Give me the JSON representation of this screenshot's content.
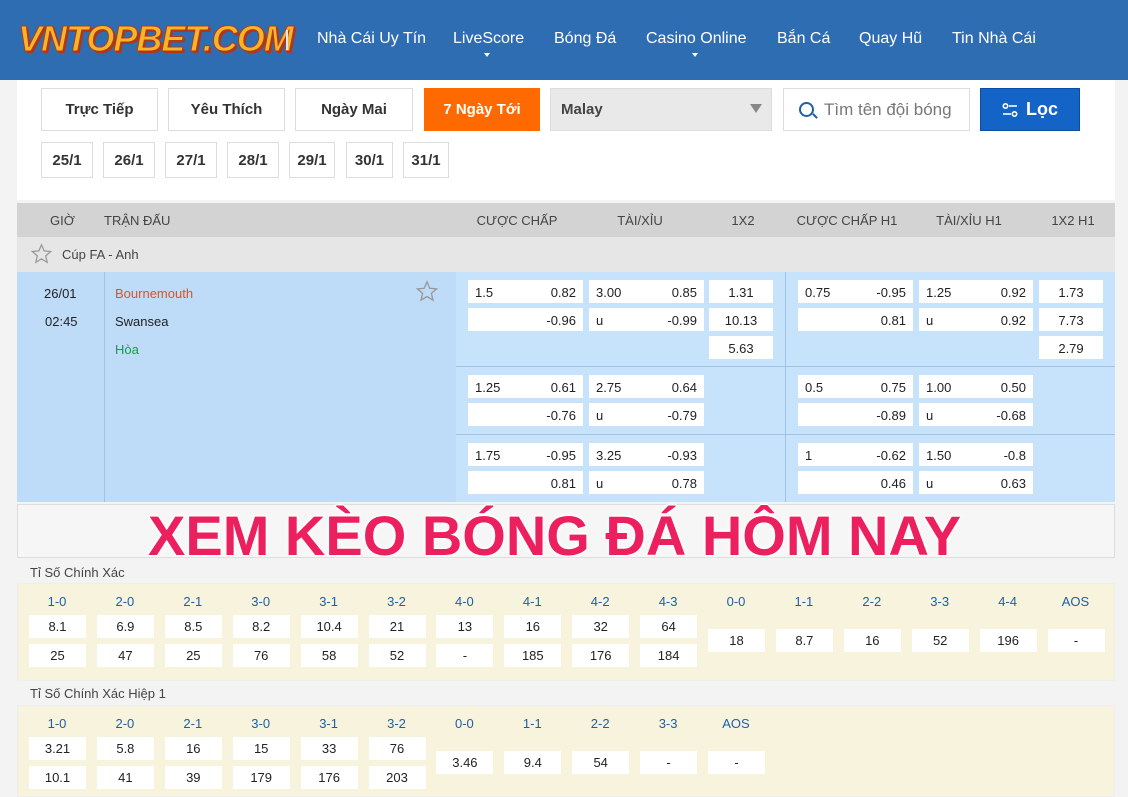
{
  "header": {
    "logo": "VNTOPBET.COM",
    "nav": [
      {
        "label": "Nhà Cái Uy Tín",
        "caret": false
      },
      {
        "label": "LiveScore",
        "caret": true
      },
      {
        "label": "Bóng Đá",
        "caret": false
      },
      {
        "label": "Casino Online",
        "caret": true
      },
      {
        "label": "Bắn Cá",
        "caret": false
      },
      {
        "label": "Quay Hũ",
        "caret": false
      },
      {
        "label": "Tin Nhà Cái",
        "caret": false
      }
    ]
  },
  "filters": {
    "tabs": [
      {
        "label": "Trực Tiếp",
        "active": false
      },
      {
        "label": "Yêu Thích",
        "active": false
      },
      {
        "label": "Ngày Mai",
        "active": false
      },
      {
        "label": "7 Ngày Tới",
        "active": true
      }
    ],
    "odds_format": "Malay",
    "search_placeholder": "Tìm tên đội bóng",
    "filter_button": "Lọc",
    "dates": [
      "25/1",
      "26/1",
      "27/1",
      "28/1",
      "29/1",
      "30/1",
      "31/1"
    ]
  },
  "table": {
    "headers": {
      "time": "GIỜ",
      "match": "TRẬN ĐẤU",
      "handicap": "CƯỢC CHẤP",
      "ou": "TÀI/XỈU",
      "x12": "1X2",
      "handicap_h1": "CƯỢC CHẤP H1",
      "ou_h1": "TÀI/XỈU H1",
      "x12_h1": "1X2 H1"
    },
    "league": "Cúp FA - Anh",
    "match": {
      "date": "26/01",
      "time": "02:45",
      "home": "Bournemouth",
      "away": "Swansea",
      "draw": "Hòa",
      "lines": [
        {
          "hdp": [
            "1.5",
            "0.82",
            "-0.96"
          ],
          "ou": [
            "3.00",
            "0.85",
            "u",
            "-0.99"
          ],
          "x12": [
            "1.31",
            "10.13",
            "5.63"
          ],
          "hdp_h1": [
            "0.75",
            "-0.95",
            "0.81"
          ],
          "ou_h1": [
            "1.25",
            "0.92",
            "u",
            "0.92"
          ],
          "x12_h1": [
            "1.73",
            "7.73",
            "2.79"
          ]
        },
        {
          "hdp": [
            "1.25",
            "0.61",
            "-0.76"
          ],
          "ou": [
            "2.75",
            "0.64",
            "u",
            "-0.79"
          ],
          "hdp_h1": [
            "0.5",
            "0.75",
            "-0.89"
          ],
          "ou_h1": [
            "1.00",
            "0.50",
            "u",
            "-0.68"
          ]
        },
        {
          "hdp": [
            "1.75",
            "-0.95",
            "0.81"
          ],
          "ou": [
            "3.25",
            "-0.93",
            "u",
            "0.78"
          ],
          "hdp_h1": [
            "1",
            "-0.62",
            "0.46"
          ],
          "ou_h1": [
            "1.50",
            "-0.8",
            "u",
            "0.63"
          ]
        }
      ]
    }
  },
  "banner": "XEM KÈO BÓNG ĐÁ HÔM NAY",
  "correct_score": {
    "title": "Tỉ Số Chính Xác",
    "items": [
      {
        "s": "1-0",
        "v": [
          "8.1",
          "25"
        ]
      },
      {
        "s": "2-0",
        "v": [
          "6.9",
          "47"
        ]
      },
      {
        "s": "2-1",
        "v": [
          "8.5",
          "25"
        ]
      },
      {
        "s": "3-0",
        "v": [
          "8.2",
          "76"
        ]
      },
      {
        "s": "3-1",
        "v": [
          "10.4",
          "58"
        ]
      },
      {
        "s": "3-2",
        "v": [
          "21",
          "52"
        ]
      },
      {
        "s": "4-0",
        "v": [
          "13",
          "-"
        ]
      },
      {
        "s": "4-1",
        "v": [
          "16",
          "185"
        ]
      },
      {
        "s": "4-2",
        "v": [
          "32",
          "176"
        ]
      },
      {
        "s": "4-3",
        "v": [
          "64",
          "184"
        ]
      },
      {
        "s": "0-0",
        "v": [
          "18"
        ]
      },
      {
        "s": "1-1",
        "v": [
          "8.7"
        ]
      },
      {
        "s": "2-2",
        "v": [
          "16"
        ]
      },
      {
        "s": "3-3",
        "v": [
          "52"
        ]
      },
      {
        "s": "4-4",
        "v": [
          "196"
        ]
      },
      {
        "s": "AOS",
        "v": [
          "-"
        ]
      }
    ]
  },
  "correct_score_h1": {
    "title": "Tỉ Số Chính Xác Hiệp 1",
    "items": [
      {
        "s": "1-0",
        "v": [
          "3.21",
          "10.1"
        ]
      },
      {
        "s": "2-0",
        "v": [
          "5.8",
          "41"
        ]
      },
      {
        "s": "2-1",
        "v": [
          "16",
          "39"
        ]
      },
      {
        "s": "3-0",
        "v": [
          "15",
          "179"
        ]
      },
      {
        "s": "3-1",
        "v": [
          "33",
          "176"
        ]
      },
      {
        "s": "3-2",
        "v": [
          "76",
          "203"
        ]
      },
      {
        "s": "0-0",
        "v": [
          "3.46"
        ]
      },
      {
        "s": "1-1",
        "v": [
          "9.4"
        ]
      },
      {
        "s": "2-2",
        "v": [
          "54"
        ]
      },
      {
        "s": "3-3",
        "v": [
          "-"
        ]
      },
      {
        "s": "AOS",
        "v": [
          "-"
        ]
      }
    ]
  },
  "colors": {
    "header_bg": "#2f6db3",
    "active_tab": "#ff6a00",
    "filter_btn": "#1463c7",
    "home_team": "#e0521f",
    "draw": "#1a9a4a",
    "banner": "#ec1f5f",
    "score_label": "#1e5fa8"
  }
}
